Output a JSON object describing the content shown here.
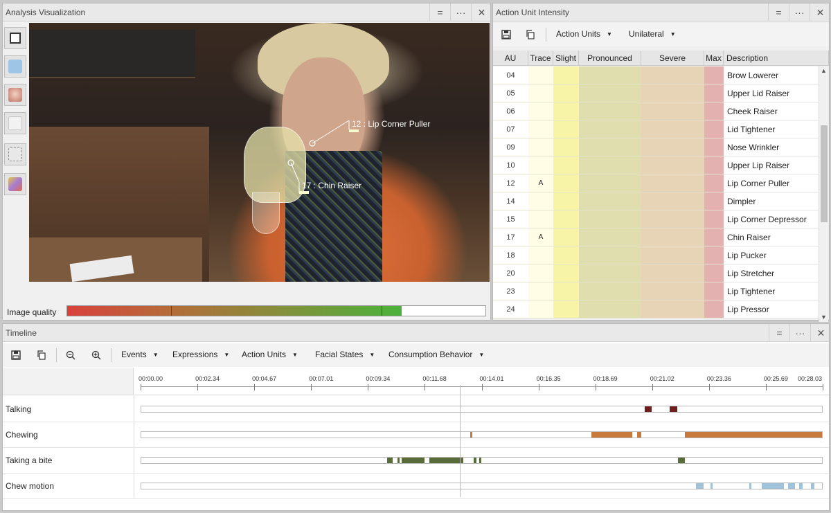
{
  "analysis": {
    "title": "Analysis Visualization",
    "overlay_labels": [
      "12 : Lip Corner Puller",
      "17 : Chin Raiser"
    ],
    "quality_label": "Image quality",
    "quality_level": 0.8
  },
  "window_buttons": {
    "dock": "=",
    "more": "···",
    "close": "✕"
  },
  "au_panel": {
    "title": "Action Unit Intensity",
    "menus": [
      "Action Units",
      "Unilateral"
    ],
    "columns": [
      "AU",
      "Trace",
      "Slight",
      "Pronounced",
      "Severe",
      "Max",
      "Description"
    ],
    "rows": [
      {
        "au": "04",
        "trace": "",
        "desc": "Brow Lowerer"
      },
      {
        "au": "05",
        "trace": "",
        "desc": "Upper Lid Raiser"
      },
      {
        "au": "06",
        "trace": "",
        "desc": "Cheek Raiser"
      },
      {
        "au": "07",
        "trace": "",
        "desc": "Lid Tightener"
      },
      {
        "au": "09",
        "trace": "",
        "desc": "Nose Wrinkler"
      },
      {
        "au": "10",
        "trace": "",
        "desc": "Upper Lip Raiser"
      },
      {
        "au": "12",
        "trace": "A",
        "desc": "Lip Corner Puller"
      },
      {
        "au": "14",
        "trace": "",
        "desc": "Dimpler"
      },
      {
        "au": "15",
        "trace": "",
        "desc": "Lip Corner Depressor"
      },
      {
        "au": "17",
        "trace": "A",
        "desc": "Chin Raiser"
      },
      {
        "au": "18",
        "trace": "",
        "desc": "Lip Pucker"
      },
      {
        "au": "20",
        "trace": "",
        "desc": "Lip Stretcher"
      },
      {
        "au": "23",
        "trace": "",
        "desc": "Lip Tightener"
      },
      {
        "au": "24",
        "trace": "",
        "desc": "Lip Pressor"
      }
    ]
  },
  "timeline": {
    "title": "Timeline",
    "menus": [
      "Events",
      "Expressions",
      "Action Units",
      "Facial States",
      "Consumption Behavior"
    ],
    "ticks": [
      "00:00.00",
      "00:02.34",
      "00:04.67",
      "00:07.01",
      "00:09.34",
      "00:11.68",
      "00:14.01",
      "00:16.35",
      "00:18.69",
      "00:21.02",
      "00:23.36",
      "00:25.69",
      "00:28.03"
    ],
    "tracks": [
      {
        "name": "Talking",
        "color": "#6e1f1f",
        "segments": [
          [
            0.74,
            0.75
          ],
          [
            0.776,
            0.787
          ]
        ]
      },
      {
        "name": "Chewing",
        "color": "#c77a3b",
        "segments": [
          [
            0.483,
            0.486
          ],
          [
            0.661,
            0.721
          ],
          [
            0.728,
            0.734
          ],
          [
            0.799,
            1.0
          ]
        ]
      },
      {
        "name": "Taking a bite",
        "color": "#5a6b3a",
        "segments": [
          [
            0.361,
            0.369
          ],
          [
            0.376,
            0.379
          ],
          [
            0.383,
            0.416
          ],
          [
            0.423,
            0.473
          ],
          [
            0.488,
            0.492
          ],
          [
            0.496,
            0.5
          ],
          [
            0.788,
            0.799
          ]
        ]
      },
      {
        "name": "Chew motion",
        "color": "#9fc3da",
        "segments": [
          [
            0.815,
            0.826
          ],
          [
            0.836,
            0.839
          ],
          [
            0.893,
            0.896
          ],
          [
            0.912,
            0.944
          ],
          [
            0.95,
            0.96
          ],
          [
            0.966,
            0.972
          ],
          [
            0.984,
            0.989
          ]
        ]
      }
    ],
    "playhead": 0.468
  }
}
